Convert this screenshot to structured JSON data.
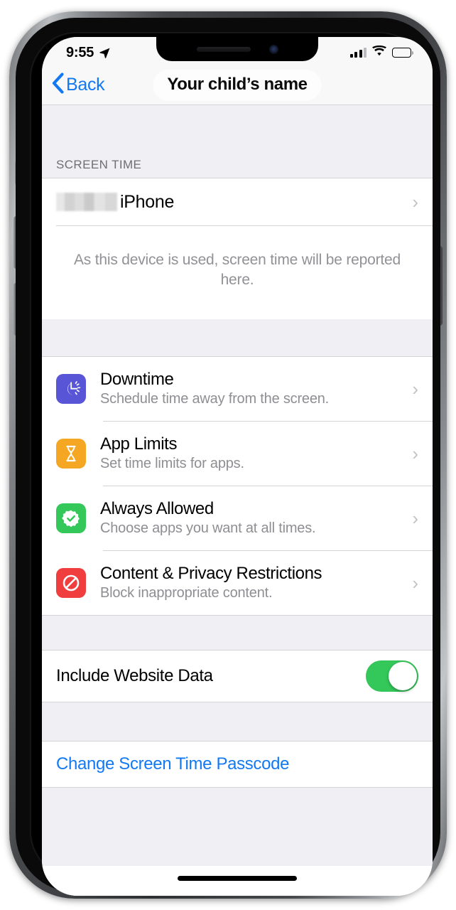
{
  "status_bar": {
    "time": "9:55",
    "location_icon": "location-arrow-icon",
    "signal_icon": "cellular-signal-icon",
    "wifi_icon": "wifi-icon",
    "battery_icon": "battery-icon"
  },
  "nav_bar": {
    "back_label": "Back",
    "back_icon": "chevron-left-icon",
    "title": "Your child’s name"
  },
  "screen_time_section": {
    "header": "SCREEN TIME",
    "device_row": {
      "redacted_name": "",
      "label": "iPhone",
      "chevron": "›"
    },
    "empty_state": "As this device is used, screen time will be reported here."
  },
  "settings_section": {
    "rows": [
      {
        "title": "Downtime",
        "subtitle": "Schedule time away from the screen.",
        "icon_name": "downtime-moon-icon",
        "icon_color": "#5856d6",
        "chevron": "›"
      },
      {
        "title": "App Limits",
        "subtitle": "Set time limits for apps.",
        "icon_name": "hourglass-icon",
        "icon_color": "#f5a623",
        "chevron": "›"
      },
      {
        "title": "Always Allowed",
        "subtitle": "Choose apps you want at all times.",
        "icon_name": "checkmark-badge-icon",
        "icon_color": "#34c759",
        "chevron": "›"
      },
      {
        "title": "Content & Privacy Restrictions",
        "subtitle": "Block inappropriate content.",
        "icon_name": "no-entry-icon",
        "icon_color": "#f03d3d",
        "chevron": "›"
      }
    ]
  },
  "website_data_section": {
    "label": "Include Website Data",
    "toggle_state": "on",
    "toggle_on_color": "#34c759"
  },
  "passcode_section": {
    "label": "Change Screen Time Passcode",
    "link_color": "#1279f2"
  },
  "home_indicator": "home-indicator"
}
